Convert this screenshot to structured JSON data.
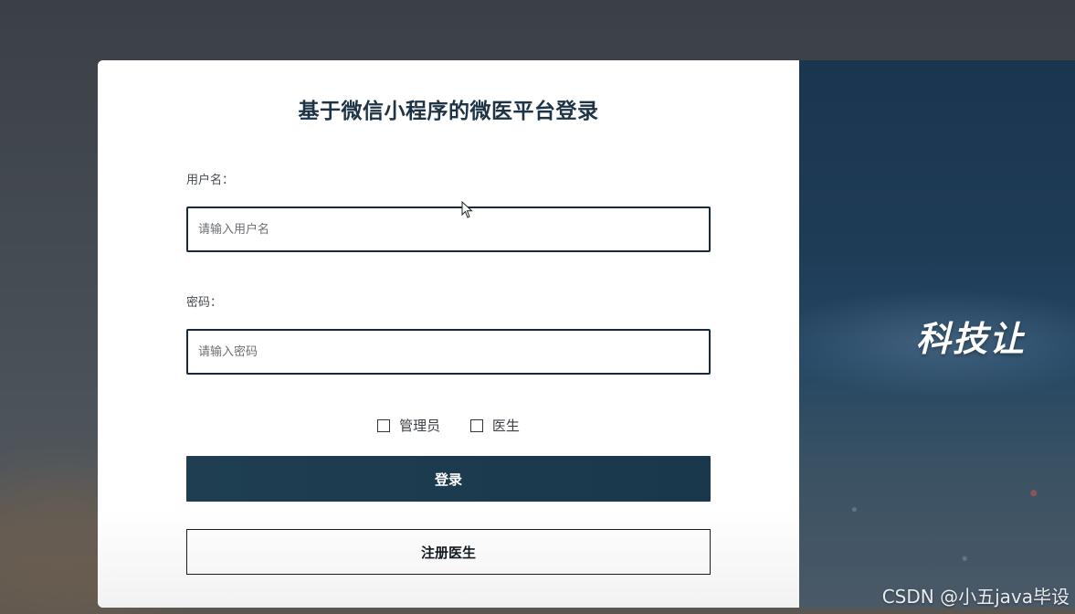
{
  "login": {
    "title": "基于微信小程序的微医平台登录",
    "username_label": "用户名：",
    "username_placeholder": "请输入用户名",
    "password_label": "密码：",
    "password_placeholder": "请输入密码",
    "roles": [
      {
        "label": "管理员",
        "checked": false
      },
      {
        "label": "医生",
        "checked": false
      }
    ],
    "login_button": "登录",
    "register_button": "注册医生"
  },
  "banner": {
    "slogan": "科技让"
  },
  "watermark": "CSDN @小五java毕设"
}
